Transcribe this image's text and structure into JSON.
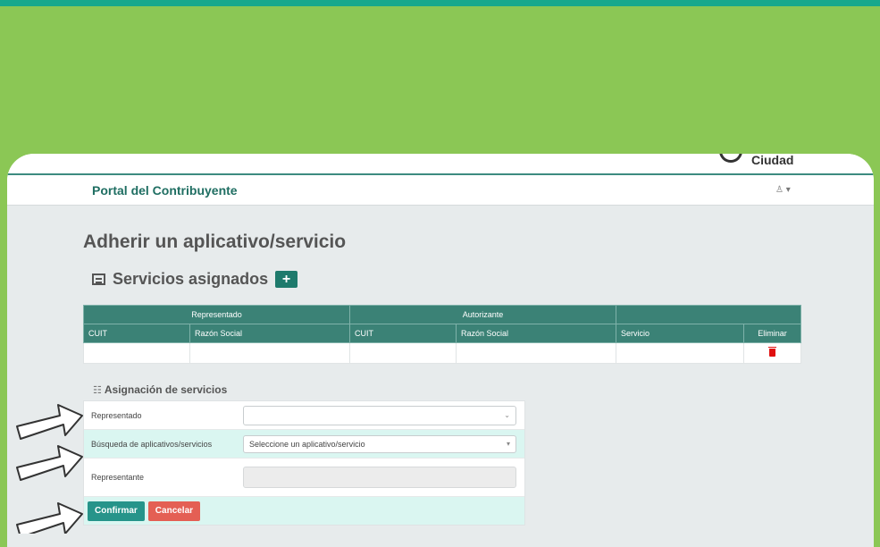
{
  "header": {
    "logo_text": "Ciudad",
    "brand": "Portal del Contribuyente",
    "user_menu": "♙ ▾"
  },
  "page": {
    "title": "Adherir un aplicativo/servicio",
    "section_title": "Servicios asignados",
    "add_label": "+"
  },
  "table": {
    "group_headers": [
      "Representado",
      "Autorizante"
    ],
    "columns": [
      "CUIT",
      "Razón Social",
      "CUIT",
      "Razón Social",
      "Servicio",
      "Eliminar"
    ]
  },
  "form": {
    "title": "Asignación de servicios",
    "fields": [
      {
        "label": "Representado",
        "value": ""
      },
      {
        "label": "Búsqueda de aplicativos/servicios",
        "value": "Seleccione un aplicativo/servicio"
      },
      {
        "label": "Representante",
        "value": ""
      }
    ],
    "confirm_label": "Confirmar",
    "cancel_label": "Cancelar"
  },
  "colors": {
    "background_green": "#8bc755",
    "header_teal": "#3b8276",
    "brand_text": "#1f6e62",
    "confirm_button": "#26948a",
    "cancel_button": "#e45f54",
    "highlight_row": "#daf6f1"
  },
  "icons": {
    "section": "table-list-icon",
    "form": "sort-list-icon",
    "delete": "trash-icon",
    "pointer": "arrow-outline-icon"
  }
}
